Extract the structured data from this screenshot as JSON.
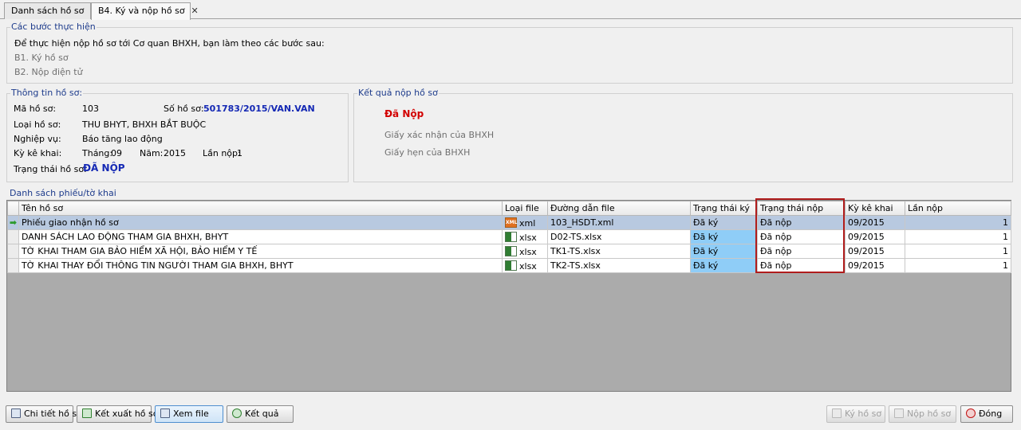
{
  "tabs": [
    {
      "label": "Danh sách hồ sơ"
    },
    {
      "label": "B4. Ký và nộp hồ sơ",
      "close": "✕"
    }
  ],
  "steps": {
    "title": "Các bước thực hiện",
    "intro": "Để thực hiện nộp hồ sơ tới Cơ quan BHXH, bạn làm theo các bước sau:",
    "step1": "B1. Ký hồ sơ",
    "step2": "B2. Nộp điện tử"
  },
  "info": {
    "title": "Thông tin hồ sơ:",
    "ma_label": "Mã hồ sơ:",
    "ma_value": "103",
    "so_label": "Số hồ sơ:",
    "so_value": "501783/2015/VAN.VAN",
    "loai_label": "Loại hồ sơ:",
    "loai_value": "THU BHYT, BHXH BẮT BUỘC",
    "nv_label": "Nghiệp vụ:",
    "nv_value": "Báo tăng lao động",
    "ky_label": "Kỳ kê khai:",
    "thang_label": "Tháng:",
    "thang_value": "09",
    "nam_label": "Năm:",
    "nam_value": "2015",
    "lan_label": "Lần nộp:",
    "lan_value": "1",
    "tt_label": "Trạng thái hồ sơ:",
    "tt_value": "ĐÃ NỘP"
  },
  "result": {
    "title": "Kết quả nộp hồ sơ",
    "status": "Đã Nộp",
    "link1": "Giấy xác nhận của BHXH",
    "link2": "Giấy hẹn của BHXH"
  },
  "list": {
    "title": "Danh sách phiếu/tờ khai",
    "columns": [
      "Tên hồ sơ",
      "Loại file",
      "Đường dẫn file",
      "Trạng thái ký",
      "Trạng thái nộp",
      "Kỳ kê khai",
      "Lần nộp"
    ],
    "rows": [
      {
        "name": "Phiếu giao nhận hồ sơ",
        "icon": "xml-file-icon",
        "type": "xml",
        "path": "103_HSDT.xml",
        "ky": "Đã ký",
        "nop": "Đã nộp",
        "period": "09/2015",
        "lan": "1"
      },
      {
        "name": "DANH SÁCH LAO ĐỘNG THAM GIA BHXH, BHYT",
        "icon": "excel-file-icon",
        "type": "xlsx",
        "path": "D02-TS.xlsx",
        "ky": "Đã ký",
        "nop": "Đã nộp",
        "period": "09/2015",
        "lan": "1"
      },
      {
        "name": "TỜ KHAI THAM GIA BẢO HIỂM XÃ HỘI, BẢO HIỂM Y TẾ",
        "icon": "excel-file-icon",
        "type": "xlsx",
        "path": "TK1-TS.xlsx",
        "ky": "Đã ký",
        "nop": "Đã nộp",
        "period": "09/2015",
        "lan": "1"
      },
      {
        "name": "TỜ KHAI THAY ĐỔI THÔNG TIN NGƯỜI THAM GIA BHXH, BHYT",
        "icon": "excel-file-icon",
        "type": "xlsx",
        "path": "TK2-TS.xlsx",
        "ky": "Đã ký",
        "nop": "Đã nộp",
        "period": "09/2015",
        "lan": "1"
      }
    ]
  },
  "buttons": {
    "chitiet": "Chi tiết hồ sơ",
    "ketxuat": "Kết xuất hồ sơ",
    "xemfile": "Xem file",
    "ketqua": "Kết quả",
    "kyhoso": "Ký hồ sơ",
    "nophoso": "Nộp hồ sơ",
    "dong": "Đóng"
  },
  "colors": {
    "accent_blue": "#1428b4",
    "status_red": "#d20000",
    "highlight_border": "#b01c1c",
    "signed_cell": "#8fcdf7"
  }
}
